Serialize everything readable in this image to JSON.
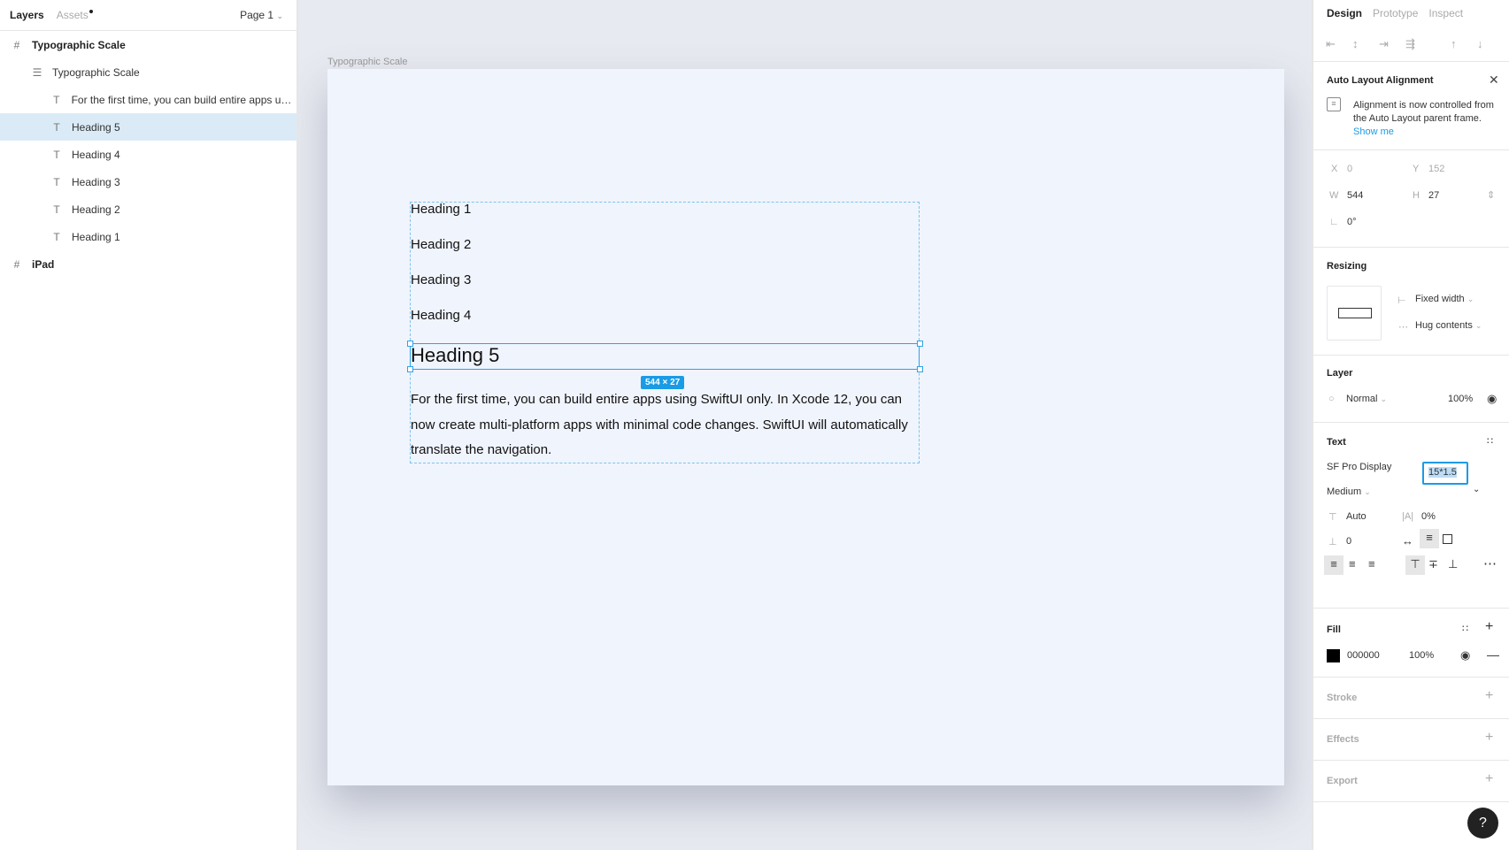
{
  "left_panel": {
    "tabs": {
      "layers": "Layers",
      "assets": "Assets"
    },
    "page": "Page 1",
    "layers": [
      {
        "label": "Typographic Scale",
        "icon": "frame-icon",
        "level": 0
      },
      {
        "label": "Typographic Scale",
        "icon": "autolayout-icon",
        "level": 1
      },
      {
        "label": "For the first time, you can build entire apps usin...",
        "icon": "text-icon",
        "level": 2
      },
      {
        "label": "Heading 5",
        "icon": "text-icon",
        "level": 2,
        "selected": true
      },
      {
        "label": "Heading 4",
        "icon": "text-icon",
        "level": 2
      },
      {
        "label": "Heading 3",
        "icon": "text-icon",
        "level": 2
      },
      {
        "label": "Heading 2",
        "icon": "text-icon",
        "level": 2
      },
      {
        "label": "Heading 1",
        "icon": "text-icon",
        "level": 2
      },
      {
        "label": "iPad",
        "icon": "frame-icon",
        "level": 0
      }
    ]
  },
  "canvas": {
    "frame_label": "Typographic Scale",
    "headings": [
      "Heading 1",
      "Heading 2",
      "Heading 3",
      "Heading 4"
    ],
    "selected_heading": "Heading 5",
    "dimension_badge": "544 × 27",
    "paragraph": "For the first time, you can build entire apps using SwiftUI only. In Xcode 12, you can now create multi-platform apps with minimal code changes. SwiftUI will automatically translate the navigation."
  },
  "right_panel": {
    "tabs": {
      "design": "Design",
      "prototype": "Prototype",
      "inspect": "Inspect"
    },
    "auto_layout": {
      "title": "Auto Layout Alignment",
      "message": "Alignment is now controlled from the Auto Layout parent frame.",
      "link": "Show me"
    },
    "position": {
      "x_label": "X",
      "x": "0",
      "y_label": "Y",
      "y": "152",
      "w_label": "W",
      "w": "544",
      "h_label": "H",
      "h": "27",
      "rotation": "0°"
    },
    "resizing": {
      "title": "Resizing",
      "horizontal": "Fixed width",
      "vertical": "Hug contents"
    },
    "layer": {
      "title": "Layer",
      "blend": "Normal",
      "opacity": "100%"
    },
    "text": {
      "title": "Text",
      "font": "SF Pro Display",
      "weight": "Medium",
      "size": "15*1.5",
      "line_height": "Auto",
      "letter_spacing": "0%",
      "paragraph_spacing": "0"
    },
    "fill": {
      "title": "Fill",
      "hex": "000000",
      "opacity": "100%",
      "color": "#000000"
    },
    "stroke": {
      "title": "Stroke"
    },
    "effects": {
      "title": "Effects"
    },
    "export": {
      "title": "Export"
    },
    "help": "?"
  }
}
